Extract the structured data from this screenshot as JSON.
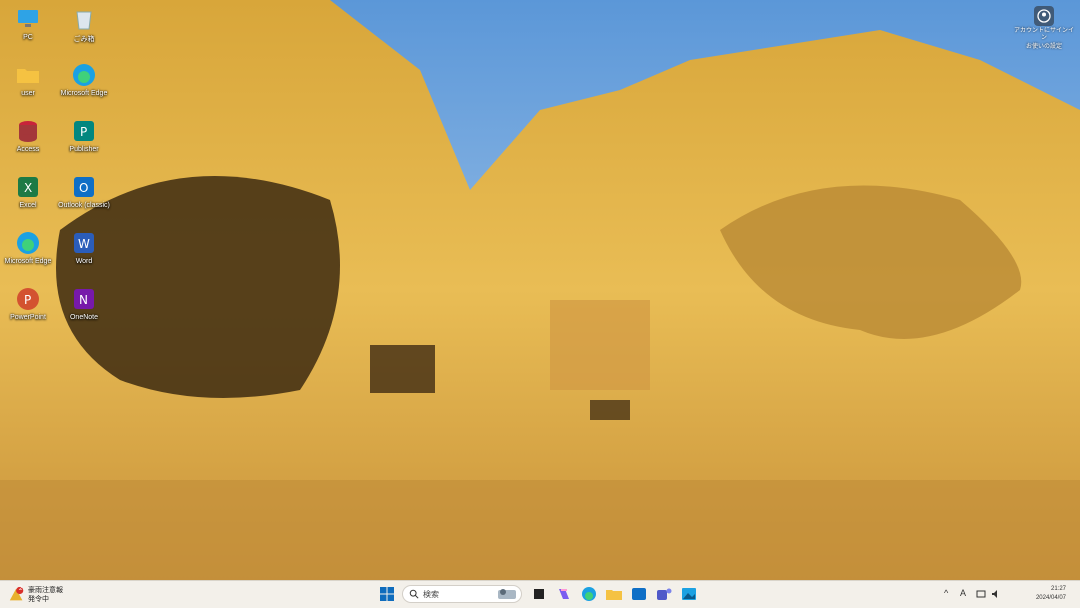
{
  "desktop": {
    "icons": [
      {
        "label": "PC",
        "icon": "monitor-icon"
      },
      {
        "label": "ごみ箱",
        "icon": "recycle-bin-icon"
      },
      {
        "label": "user",
        "icon": "folder-icon"
      },
      {
        "label": "Microsoft Edge",
        "icon": "edge-icon"
      },
      {
        "label": "Access",
        "icon": "access-icon"
      },
      {
        "label": "Publisher",
        "icon": "publisher-icon"
      },
      {
        "label": "Excel",
        "icon": "excel-icon"
      },
      {
        "label": "Outlook (classic)",
        "icon": "outlook-icon"
      },
      {
        "label": "Microsoft Edge",
        "icon": "edge-icon"
      },
      {
        "label": "Word",
        "icon": "word-icon"
      },
      {
        "label": "PowerPoint",
        "icon": "powerpoint-icon"
      },
      {
        "label": "OneNote",
        "icon": "onenote-icon"
      }
    ],
    "user_widget": {
      "line1": "アカウントにサインイン",
      "line2": "お使いの設定"
    }
  },
  "taskbar": {
    "weather": {
      "line1": "豪雨注意報",
      "line2": "発令中",
      "badge": "2"
    },
    "search_placeholder": "検索",
    "pinned": [
      "start-icon",
      "search-icon",
      "task-view-icon",
      "copilot-icon",
      "edge-icon",
      "file-explorer-icon",
      "outlook-icon",
      "teams-icon",
      "photos-icon"
    ],
    "clock": {
      "time": "21:27",
      "date": "2024/04/07"
    }
  },
  "colors": {
    "taskbar_bg": "#f3f0ea",
    "accent": "#0067c0"
  }
}
